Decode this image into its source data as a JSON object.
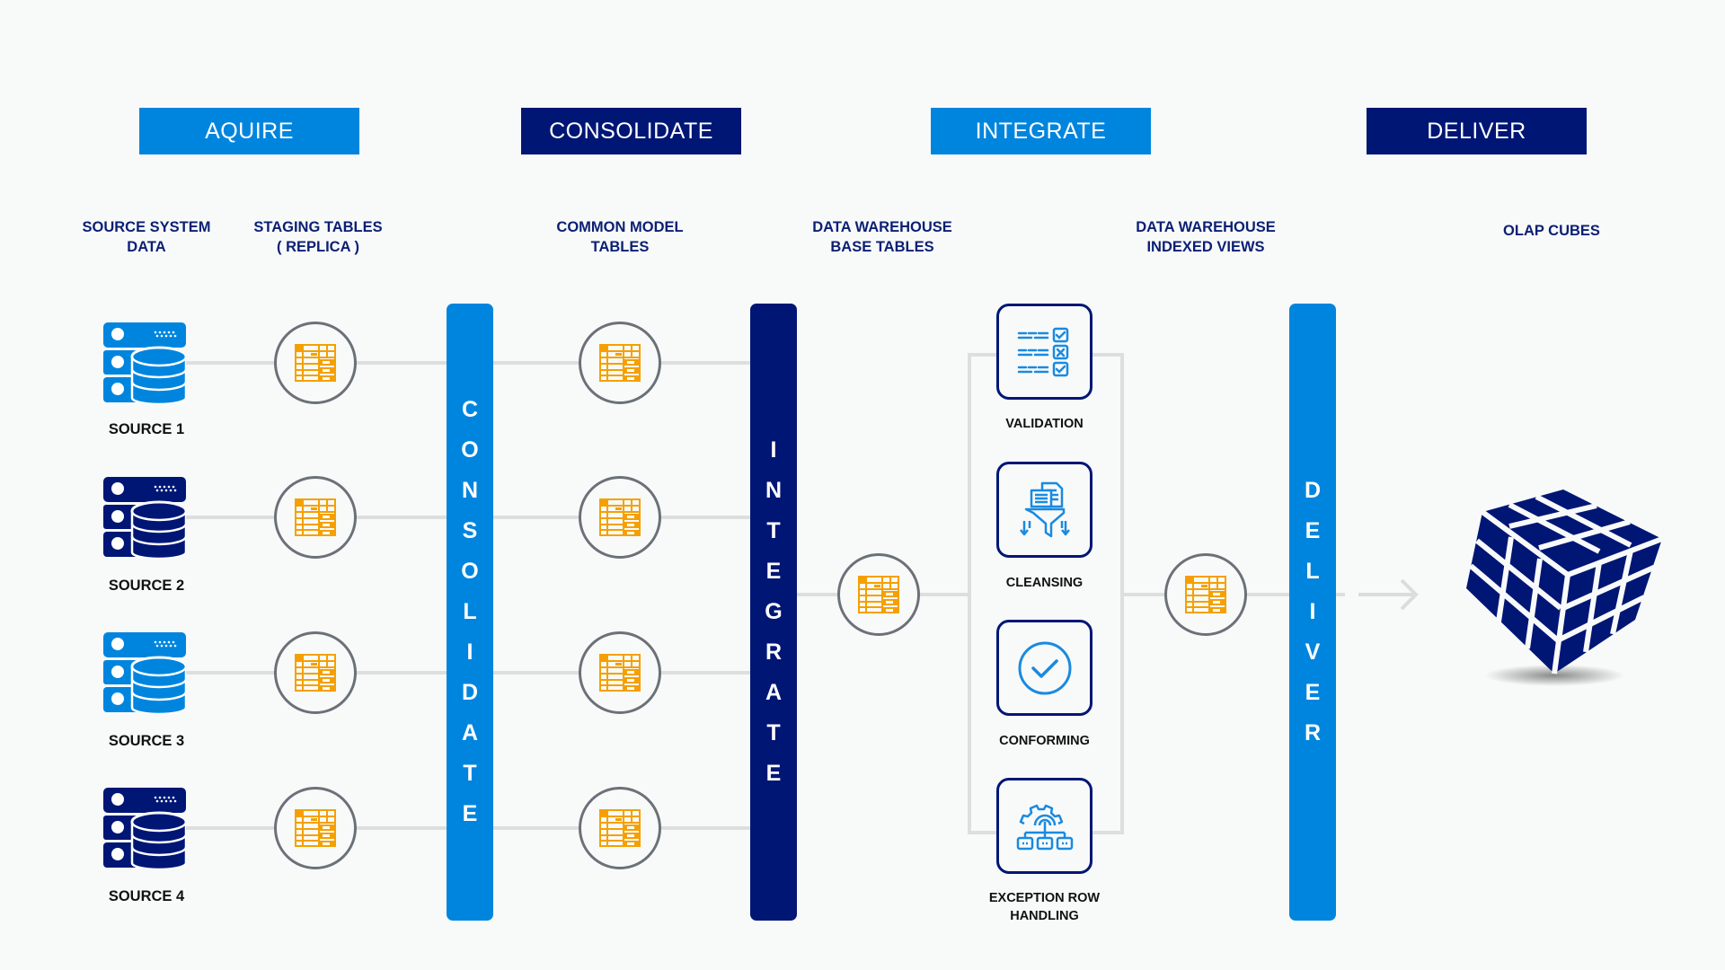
{
  "stages": [
    {
      "label": "AQUIRE",
      "color": "#0085de"
    },
    {
      "label": "CONSOLIDATE",
      "color": "#001675"
    },
    {
      "label": "INTEGRATE",
      "color": "#0085de"
    },
    {
      "label": "DELIVER",
      "color": "#001675"
    }
  ],
  "column_labels": {
    "source_system": [
      "SOURCE SYSTEM",
      "DATA"
    ],
    "staging": [
      "STAGING TABLES",
      "( REPLICA )"
    ],
    "common_model": [
      "COMMON MODEL",
      "TABLES"
    ],
    "dw_base": [
      "DATA WAREHOUSE",
      "BASE TABLES"
    ],
    "dw_indexed": [
      "DATA WAREHOUSE",
      "INDEXED VIEWS"
    ],
    "olap": [
      "OLAP CUBES"
    ]
  },
  "sources": [
    {
      "label": "SOURCE 1",
      "icon": "database-server-icon",
      "color": "#0085de"
    },
    {
      "label": "SOURCE 2",
      "icon": "database-server-icon",
      "color": "#001675"
    },
    {
      "label": "SOURCE 3",
      "icon": "database-server-icon",
      "color": "#0085de"
    },
    {
      "label": "SOURCE 4",
      "icon": "database-server-icon",
      "color": "#001675"
    }
  ],
  "bars": {
    "consolidate": {
      "letters": [
        "C",
        "O",
        "N",
        "S",
        "O",
        "L",
        "I",
        "D",
        "A",
        "T",
        "E"
      ],
      "color": "#0085de"
    },
    "integrate": {
      "letters": [
        "I",
        "N",
        "T",
        "E",
        "G",
        "R",
        "A",
        "T",
        "E"
      ],
      "color": "#001675"
    },
    "deliver": {
      "letters": [
        "D",
        "E",
        "L",
        "I",
        "V",
        "E",
        "R"
      ],
      "color": "#0085de"
    }
  },
  "processes": [
    {
      "label": "VALIDATION",
      "icon": "checklist-icon"
    },
    {
      "label": "CLEANSING",
      "icon": "filter-funnel-icon"
    },
    {
      "label": "CONFORMING",
      "icon": "check-circle-icon"
    },
    {
      "label": "EXCEPTION ROW",
      "label2": "HANDLING",
      "icon": "gear-hierarchy-icon"
    }
  ],
  "icons": {
    "table": "table-icon",
    "arrow": "arrow-right-icon",
    "cube": "olap-cube-icon"
  },
  "colors": {
    "table_orange": "#f5a000",
    "line_gray": "#dedede",
    "circle_border": "#6b7178"
  }
}
